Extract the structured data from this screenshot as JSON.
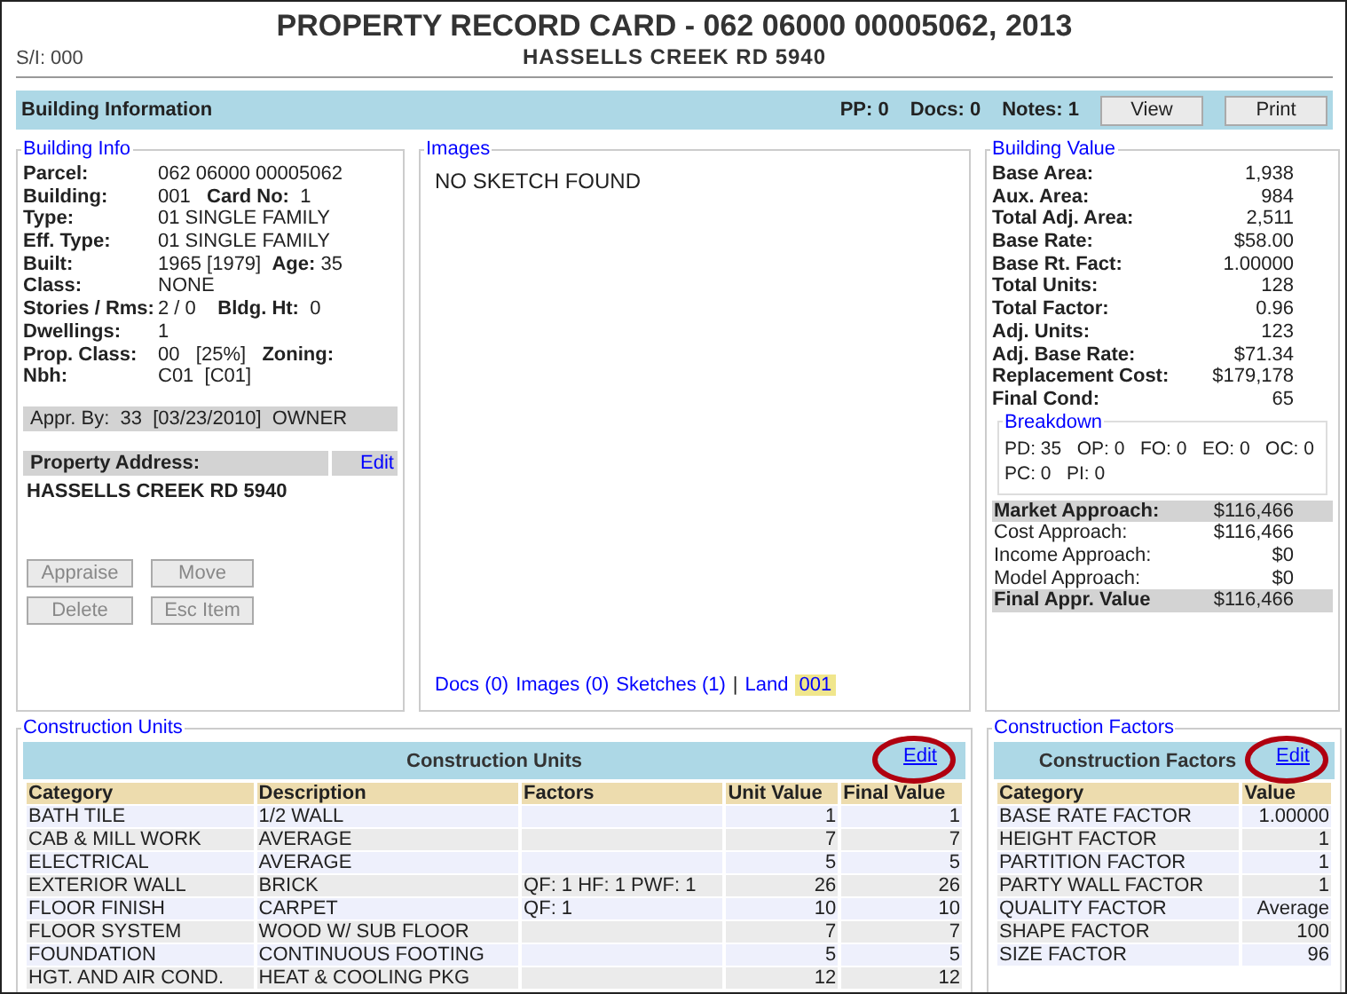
{
  "header": {
    "title": "PROPERTY RECORD CARD - 062 06000 00005062, 2013",
    "si": "S/I: 000",
    "subtitle": "HASSELLS CREEK RD 5940"
  },
  "toolbar": {
    "title": "Building Information",
    "counts": [
      "PP: 0",
      "Docs: 0",
      "Notes: 1"
    ],
    "buttons": [
      "View",
      "Print"
    ]
  },
  "building_info": {
    "legend": "Building Info",
    "fields": [
      {
        "label": "Parcel:",
        "value": "062 06000 00005062"
      },
      {
        "label": "Building:",
        "value": "001   **Card No:**  1"
      },
      {
        "label": "Type:",
        "value": "01 SINGLE FAMILY"
      },
      {
        "label": "Eff. Type:",
        "value": "01 SINGLE FAMILY"
      },
      {
        "label": "Built:",
        "value": "1965 [1979]  **Age:** 35"
      },
      {
        "label": "Class:",
        "value": "NONE"
      },
      {
        "label": "Stories / Rms:",
        "value": "2 / 0    **Bldg. Ht:**  0"
      },
      {
        "label": "Dwellings:",
        "value": "1"
      },
      {
        "label": "Prop. Class:",
        "value": "00   [25%]   **Zoning:**"
      },
      {
        "label": "Nbh:",
        "value": "C01  [C01]"
      }
    ],
    "appraised_by": "Appr. By:  33  [03/23/2010]  OWNER",
    "address_label": "Property Address:",
    "address_edit": "Edit",
    "address": "HASSELLS CREEK RD 5940",
    "buttons": [
      {
        "label": "Appraise",
        "disabled": true
      },
      {
        "label": "Move",
        "disabled": true
      },
      {
        "label": "Delete",
        "disabled": true
      },
      {
        "label": "Esc Item",
        "disabled": true
      }
    ]
  },
  "images": {
    "legend": "Images",
    "message": "NO SKETCH FOUND",
    "links": [
      {
        "kind": "link",
        "text": "Docs (0)"
      },
      {
        "kind": "link",
        "text": "Images (0)"
      },
      {
        "kind": "link",
        "text": "Sketches (1)"
      },
      {
        "kind": "separator",
        "text": "|"
      },
      {
        "kind": "link",
        "text": "Land"
      },
      {
        "kind": "tag",
        "text": "001"
      }
    ]
  },
  "building_value": {
    "legend": "Building Value",
    "rows": [
      {
        "label": "Base Area:",
        "value": "1,938"
      },
      {
        "label": "Aux. Area:",
        "value": "984"
      },
      {
        "label": "Total Adj. Area:",
        "value": "2,511"
      },
      {
        "label": "Base Rate:",
        "value": "$58.00"
      },
      {
        "label": "Base Rt. Fact:",
        "value": "1.00000"
      },
      {
        "label": "Total Units:",
        "value": "128"
      },
      {
        "label": "Total Factor:",
        "value": "0.96"
      },
      {
        "label": "Adj. Units:",
        "value": "123"
      },
      {
        "label": "Adj. Base Rate:",
        "value": "$71.34"
      },
      {
        "label": "Replacement Cost:",
        "value": "$179,178"
      },
      {
        "label": "Final Cond:",
        "value": "65"
      }
    ],
    "breakdown": {
      "legend": "Breakdown",
      "lines": [
        "PD: 35   OP: 0   FO: 0   EO: 0   OC: 0",
        "PC: 0   PI: 0"
      ]
    },
    "approaches": [
      {
        "label": "Market Approach:",
        "value": "$116,466",
        "highlighted": true
      },
      {
        "label": "Cost Approach:",
        "value": "$116,466",
        "highlighted": false
      },
      {
        "label": "Income Approach:",
        "value": "$0",
        "highlighted": false
      },
      {
        "label": "Model Approach:",
        "value": "$0",
        "highlighted": false
      },
      {
        "label": "Final Appr. Value",
        "value": "$116,466",
        "highlighted": true
      }
    ]
  },
  "construction_units": {
    "legend": "Construction Units",
    "title": "Construction Units",
    "edit": {
      "label": "Edit",
      "circled": true
    },
    "columns": [
      "Category",
      "Description",
      "Factors",
      "Unit Value",
      "Final Value"
    ],
    "rows": [
      [
        "BATH TILE",
        "1/2 WALL",
        "",
        "1",
        "1"
      ],
      [
        "CAB & MILL WORK",
        "AVERAGE",
        "",
        "7",
        "7"
      ],
      [
        "ELECTRICAL",
        "AVERAGE",
        "",
        "5",
        "5"
      ],
      [
        "EXTERIOR WALL",
        "BRICK",
        "QF: 1 HF: 1 PWF: 1",
        "26",
        "26"
      ],
      [
        "FLOOR FINISH",
        "CARPET",
        "QF: 1",
        "10",
        "10"
      ],
      [
        "FLOOR SYSTEM",
        "WOOD W/ SUB FLOOR",
        "",
        "7",
        "7"
      ],
      [
        "FOUNDATION",
        "CONTINUOUS FOOTING",
        "",
        "5",
        "5"
      ],
      [
        "HGT. AND AIR COND.",
        "HEAT & COOLING PKG",
        "",
        "12",
        "12"
      ]
    ]
  },
  "construction_factors": {
    "legend": "Construction Factors",
    "title": "Construction Factors",
    "edit": {
      "label": "Edit",
      "circled": true
    },
    "columns": [
      "Category",
      "Value"
    ],
    "rows": [
      [
        "BASE RATE FACTOR",
        "1.00000"
      ],
      [
        "HEIGHT FACTOR",
        "1"
      ],
      [
        "PARTITION FACTOR",
        "1"
      ],
      [
        "PARTY WALL FACTOR",
        "1"
      ],
      [
        "QUALITY FACTOR",
        "Average"
      ],
      [
        "SHAPE FACTOR",
        "100"
      ],
      [
        "SIZE FACTOR",
        "96"
      ]
    ]
  }
}
